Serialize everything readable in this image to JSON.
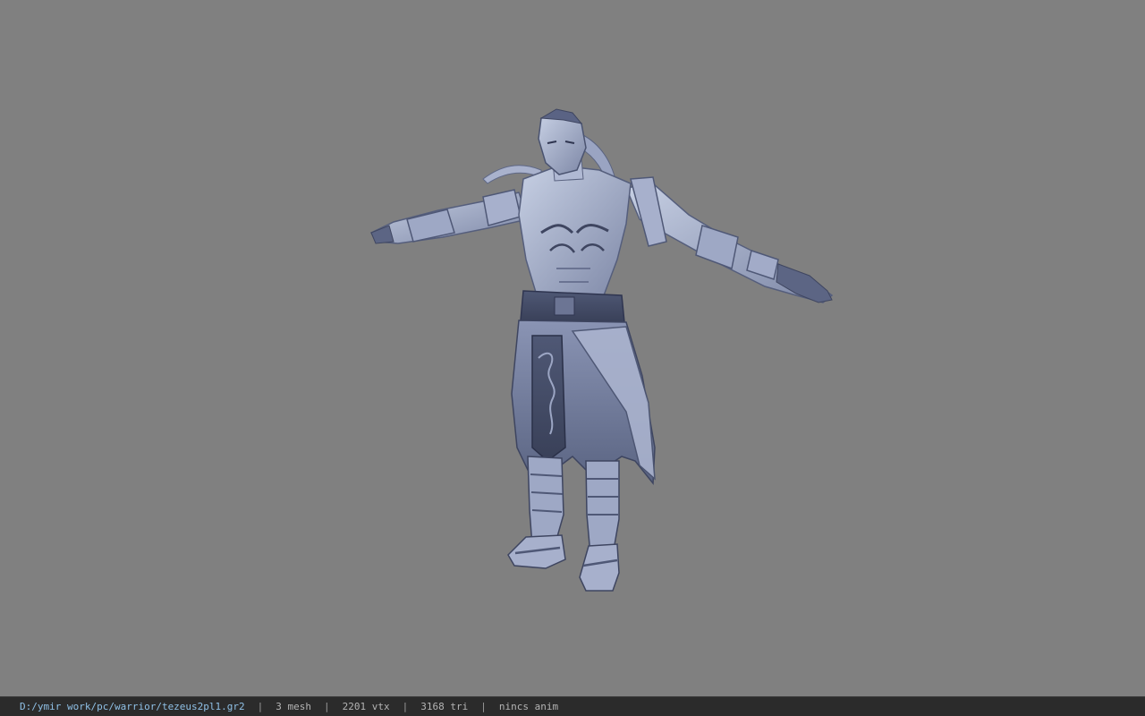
{
  "viewport": {
    "background_color": "#808080",
    "model_render": "t-pose-warrior-character"
  },
  "statusbar": {
    "file_path": "D:/ymir work/pc/warrior/tezeus2pl1.gr2",
    "separator": "|",
    "mesh": "3 mesh",
    "vertices": "2201 vtx",
    "triangles": "3168 tri",
    "animation": "nincs anim"
  }
}
